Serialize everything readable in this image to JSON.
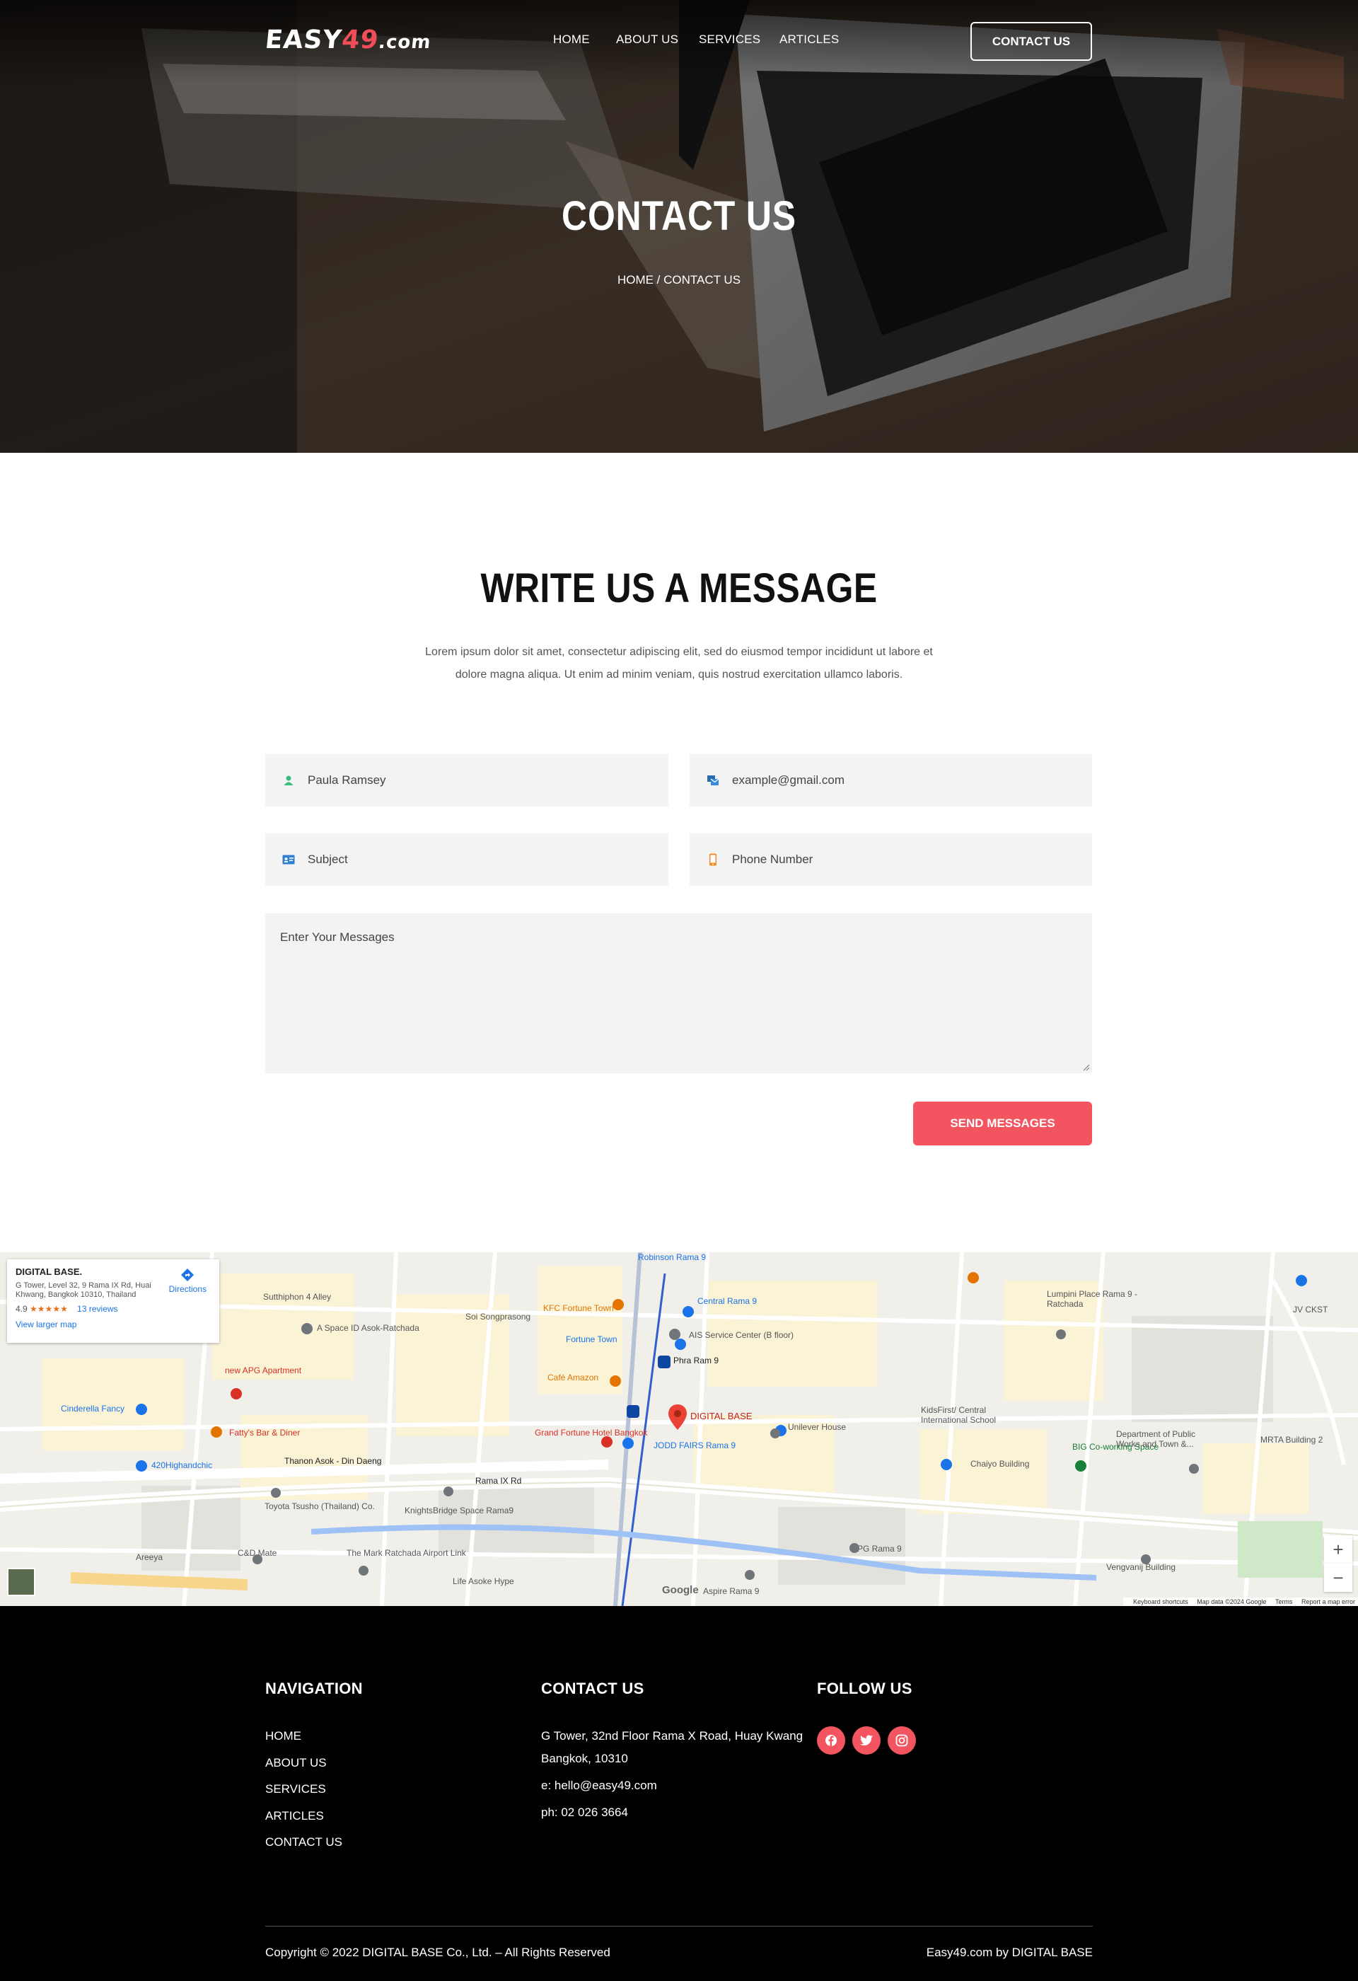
{
  "colors": {
    "accent": "#f25560",
    "footer_bg": "#000000",
    "field_bg": "#f3f3f3"
  },
  "header": {
    "logo": {
      "part1": "EASY",
      "part2": "49",
      "part3": ".com"
    },
    "nav": [
      "HOME",
      "ABOUT US",
      "SERVICES",
      "ARTICLES"
    ],
    "cta": "CONTACT US"
  },
  "hero": {
    "title": "CONTACT US",
    "breadcrumb": "HOME / CONTACT US"
  },
  "message": {
    "title": "WRITE US A MESSAGE",
    "description": "Lorem ipsum dolor sit amet, consectetur adipiscing elit, sed do eiusmod tempor incididunt ut labore et dolore magna aliqua. Ut enim ad minim veniam, quis nostrud exercitation ullamco laboris.",
    "fields": {
      "name_placeholder": "Paula Ramsey",
      "email_placeholder": "example@gmail.com",
      "subject_placeholder": "Subject",
      "phone_placeholder": "Phone Number",
      "message_placeholder": "Enter Your Messages"
    },
    "send_label": "SEND MESSAGES",
    "icons": [
      "user-icon",
      "email-icon",
      "id-card-icon",
      "phone-icon"
    ]
  },
  "map": {
    "card": {
      "title": "DIGITAL BASE.",
      "address": "G Tower, Level 32, 9 Rama IX Rd, Huai Khwang, Bangkok 10310, Thailand",
      "rating": "4.9",
      "stars": "★★★★★",
      "reviews": "13 reviews",
      "larger_map": "View larger map",
      "directions": "Directions"
    },
    "marker_label": "DIGITAL BASE",
    "labels": [
      "Robinson Rama 9",
      "Central Rama 9",
      "KFC Fortune Town",
      "Fortune Town",
      "AIS Service Center (B floor)",
      "Phra Ram 9",
      "Café Amazon",
      "Grand Fortune Hotel Bangkok",
      "JODD FAIRS Rama 9",
      "Unilever House",
      "KidsFirst/ Central International School",
      "Chaiyo Building",
      "BIG Co-working Space",
      "Lumpini Place Rama 9 - Ratchada",
      "JV CKST",
      "MRTA Building 2",
      "Department of Public Works and Town &...",
      "Rama IX Rd",
      "Thanon Asok - Din Daeng",
      "new APG Apartment",
      "Fatty's Bar & Diner",
      "420Highandchic",
      "Cinderella Fancy",
      "A Space ID Asok-Ratchada",
      "Toyota Tsusho (Thailand) Co.",
      "KnightsBridge Space Rama9",
      "The Mark Ratchada Airport Link",
      "Life Asoke Hype",
      "PG Rama 9",
      "Vengvanij Building",
      "Aspire Rama 9",
      "C&D Mate",
      "Areeya",
      "Sutthiphon 4 Alley",
      "Soi Songprasong"
    ],
    "zoom_in": "+",
    "zoom_out": "−",
    "attribution": [
      "Keyboard shortcuts",
      "Map data ©2024 Google",
      "Terms",
      "Report a map error"
    ],
    "google": "Google"
  },
  "footer": {
    "nav_title": "NAVIGATION",
    "nav_links": [
      "HOME",
      "ABOUT US",
      "SERVICES",
      "ARTICLES",
      "CONTACT US"
    ],
    "contact_title": "CONTACT US",
    "address_line1": "G Tower, 32nd Floor Rama X Road, Huay Kwang",
    "address_line2": "Bangkok, 10310",
    "email": "e: hello@easy49.com",
    "phone": "ph: 02 026 3664",
    "follow_title": "FOLLOW US",
    "social_icons": [
      "facebook-icon",
      "twitter-icon",
      "instagram-icon"
    ],
    "copyright": "Copyright © 2022 DIGITAL BASE Co., Ltd. – All Rights Reserved",
    "credit": "Easy49.com by DIGITAL BASE"
  }
}
